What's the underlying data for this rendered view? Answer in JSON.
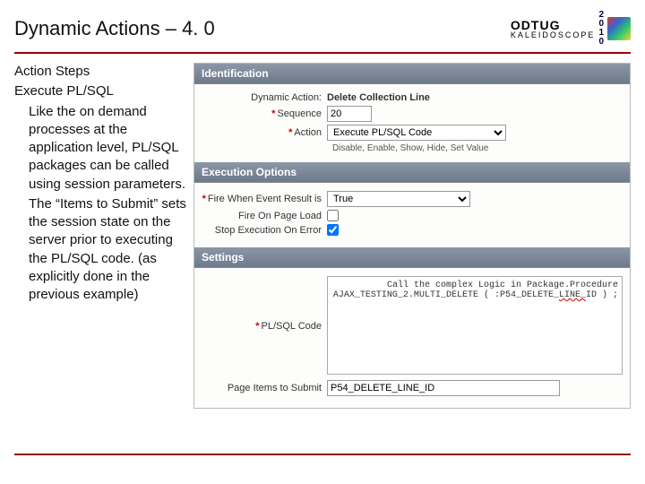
{
  "page": {
    "title": "Dynamic Actions – 4. 0",
    "logo": {
      "main": "ODTUG",
      "sub": "KALEIDOSCOPE",
      "year": "2010"
    }
  },
  "left": {
    "l1": "Action Steps",
    "l2": "Execute PL/SQL",
    "l3": "Like the on demand processes at the application level, PL/SQL packages can be called using session parameters.",
    "l4": "The “Items to Submit” sets the session state on the server prior to executing the PL/SQL code. (as explicitly done in the previous example)"
  },
  "panel": {
    "identification": {
      "heading": "Identification",
      "dynamic_action_label": "Dynamic Action:",
      "dynamic_action_value": "Delete Collection Line",
      "sequence_label": "Sequence",
      "sequence_value": "20",
      "action_label": "Action",
      "action_value": "Execute PL/SQL Code",
      "action_hint": "Disable, Enable, Show, Hide, Set Value"
    },
    "execution": {
      "heading": "Execution Options",
      "fire_when_label": "Fire When Event Result is",
      "fire_when_value": "True",
      "fire_on_load_label": "Fire On Page Load",
      "stop_on_error_label": "Stop Execution On Error"
    },
    "settings": {
      "heading": "Settings",
      "code_label": "PL/SQL Code",
      "code_line1": "Call the complex Logic in Package.Procedure",
      "code_line2a": "AJAX_TESTING_2.MULTI_DELETE ( :P54_DELETE_",
      "code_line2b": "LINE_",
      "code_line2c": "ID ) ;",
      "items_label": "Page Items to Submit",
      "items_value": "P54_DELETE_LINE_ID"
    }
  }
}
